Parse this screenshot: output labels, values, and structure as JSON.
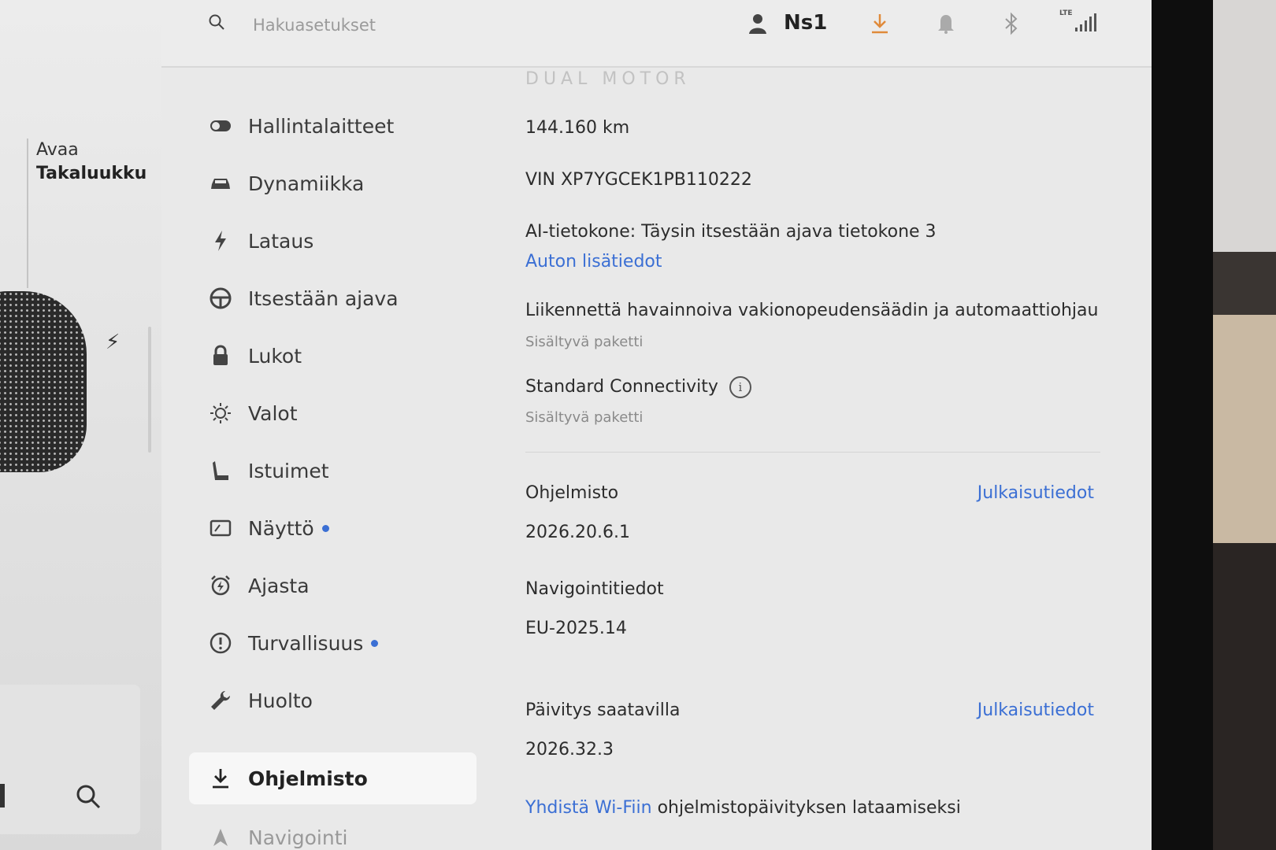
{
  "left_panel": {
    "trunk_line1": "Avaa",
    "trunk_line2": "Takaluukku"
  },
  "header": {
    "search_placeholder": "Hakuasetukset",
    "profile_name": "Ns1",
    "signal_label": "LTE"
  },
  "nav": {
    "items": [
      {
        "label": "Hallintalaitteet",
        "icon": "toggle-icon"
      },
      {
        "label": "Dynamiikka",
        "icon": "car-icon"
      },
      {
        "label": "Lataus",
        "icon": "bolt-icon"
      },
      {
        "label": "Itsestään ajava",
        "icon": "steering-wheel-icon"
      },
      {
        "label": "Lukot",
        "icon": "lock-icon"
      },
      {
        "label": "Valot",
        "icon": "light-icon"
      },
      {
        "label": "Istuimet",
        "icon": "seat-icon"
      },
      {
        "label": "Näyttö",
        "icon": "display-icon"
      },
      {
        "label": "Ajasta",
        "icon": "alarm-icon"
      },
      {
        "label": "Turvallisuus",
        "icon": "alert-icon"
      },
      {
        "label": "Huolto",
        "icon": "wrench-icon"
      },
      {
        "label": "Ohjelmisto",
        "icon": "download-icon"
      },
      {
        "label": "Navigointi",
        "icon": "navigation-icon"
      }
    ],
    "active": "Ohjelmisto",
    "badge_color": "#3b6fd4"
  },
  "content": {
    "motor_label": "DUAL MOTOR",
    "odometer": "144.160  km",
    "vin": "VIN XP7YGCEK1PB110222",
    "ai_computer": "AI-tietokone: Täysin itsestään ajava tietokone 3",
    "vehicle_details_link": "Auton lisätiedot",
    "autopilot_package": "Liikennettä havainnoiva vakionopeudensäädin ja automaattiohjau",
    "autopilot_package_status": "Sisältyvä paketti",
    "connectivity": "Standard Connectivity",
    "connectivity_status": "Sisältyvä paketti",
    "software_title": "Ohjelmisto",
    "software_release_notes": "Julkaisutiedot",
    "software_version": "2026.20.6.1",
    "nav_data_title": "Navigointitiedot",
    "nav_data_version": "EU-2025.14",
    "update_title": "Päivitys saatavilla",
    "update_release_notes": "Julkaisutiedot",
    "update_version": "2026.32.3",
    "wifi_link": "Yhdistä Wi-Fiin",
    "wifi_text": " ohjelmistopäivityksen lataamiseksi",
    "link_color": "#3b6fd4"
  }
}
